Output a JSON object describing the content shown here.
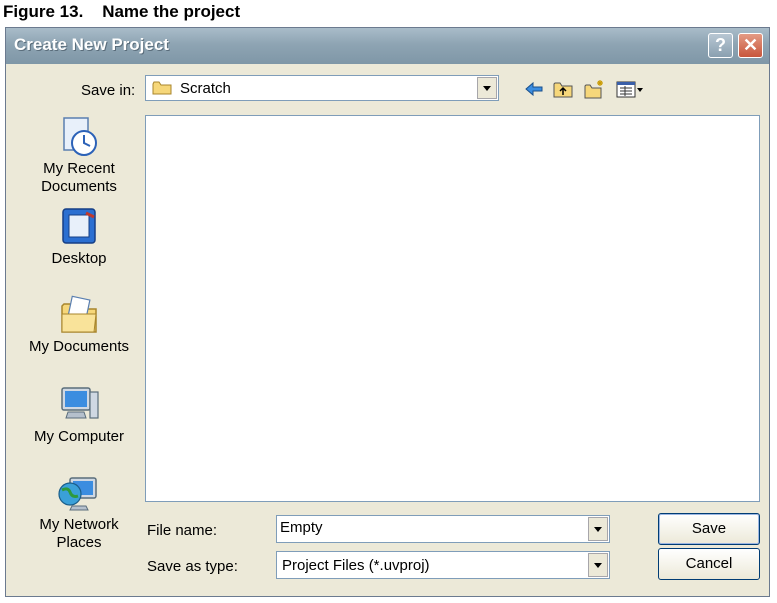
{
  "figure_caption": "Figure 13.    Name the project",
  "window": {
    "title": "Create New Project",
    "help_icon": "question-mark-icon",
    "close_icon": "close-x-icon"
  },
  "save_in": {
    "label": "Save in:",
    "value": "Scratch",
    "icon": "folder-icon"
  },
  "toolbar": {
    "icons": [
      "back-arrow-icon",
      "up-one-level-icon",
      "new-folder-icon",
      "view-menu-icon"
    ]
  },
  "places": [
    {
      "label": "My Recent\nDocuments",
      "icon": "recent-documents-icon"
    },
    {
      "label": "Desktop",
      "icon": "desktop-icon"
    },
    {
      "label": "My Documents",
      "icon": "my-documents-icon"
    },
    {
      "label": "My Computer",
      "icon": "my-computer-icon"
    },
    {
      "label": "My Network\nPlaces",
      "icon": "network-places-icon"
    }
  ],
  "file_name": {
    "label": "File name:",
    "value": "Empty"
  },
  "save_as_type": {
    "label": "Save as type:",
    "value": "Project Files (*.uvproj)"
  },
  "buttons": {
    "save": "Save",
    "cancel": "Cancel"
  },
  "colors": {
    "dialog_bg": "#ece9d8",
    "titlebar": "#8ea4b3",
    "close_button": "#c8563c"
  }
}
